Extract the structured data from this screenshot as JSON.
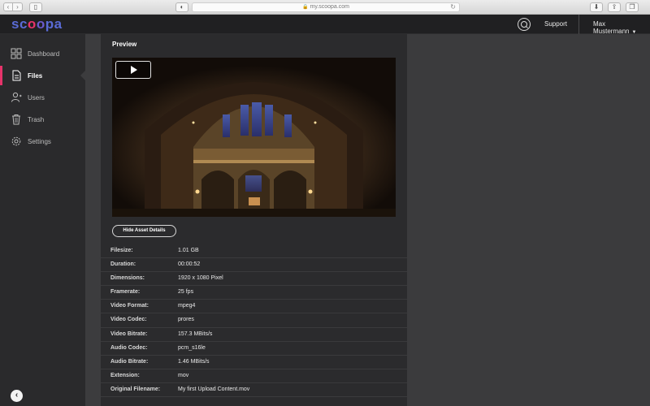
{
  "browser": {
    "url": "my.scoopa.com",
    "nav_back": "‹",
    "nav_forward": "›"
  },
  "app": {
    "logo_parts": [
      "sc",
      "o",
      "o",
      "pa"
    ],
    "support_label": "Support",
    "user_name": "Max Mustermann"
  },
  "sidebar": {
    "items": [
      {
        "label": "Dashboard",
        "icon": "grid-icon"
      },
      {
        "label": "Files",
        "icon": "file-icon"
      },
      {
        "label": "Users",
        "icon": "users-icon"
      },
      {
        "label": "Trash",
        "icon": "trash-icon"
      },
      {
        "label": "Settings",
        "icon": "gear-icon"
      }
    ],
    "active_index": 1
  },
  "panel": {
    "title": "Preview",
    "hide_details_label": "Hide Asset Details",
    "details": [
      {
        "key": "Filesize:",
        "value": "1.01 GB"
      },
      {
        "key": "Duration:",
        "value": "00:00:52"
      },
      {
        "key": "Dimensions:",
        "value": "1920 x 1080 Pixel"
      },
      {
        "key": "Framerate:",
        "value": "25 fps"
      },
      {
        "key": "Video Format:",
        "value": "mpeg4"
      },
      {
        "key": "Video Codec:",
        "value": "prores"
      },
      {
        "key": "Video Bitrate:",
        "value": "157.3 MBits/s"
      },
      {
        "key": "Audio Codec:",
        "value": "pcm_s16le"
      },
      {
        "key": "Audio Bitrate:",
        "value": "1.46 MBits/s"
      },
      {
        "key": "Extension:",
        "value": "mov"
      },
      {
        "key": "Original Filename:",
        "value": "My first Upload Content.mov"
      }
    ]
  },
  "colors": {
    "accent": "#e6336a",
    "logo_blue": "#5a6bd6",
    "sidebar_bg": "#2a2a2c",
    "panel_bg": "#2b2b2d"
  }
}
